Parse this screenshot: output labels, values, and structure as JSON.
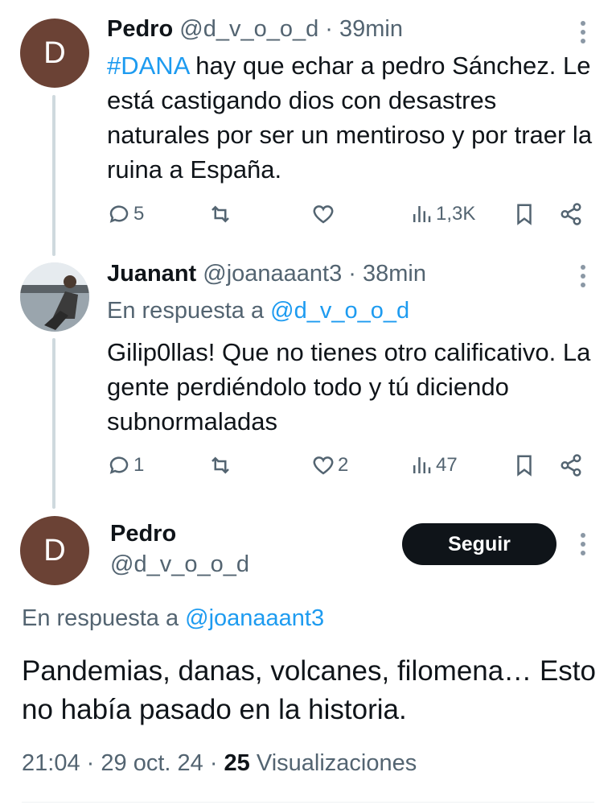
{
  "tweet1": {
    "avatar_letter": "D",
    "name": "Pedro",
    "handle": "@d_v_o_o_d",
    "separator": "·",
    "time": "39min",
    "hashtag": "#DANA",
    "text": " hay que echar a pedro Sánchez. Le está castigando dios con desastres naturales por ser un mentiroso y por traer la ruina a España.",
    "replies": "5",
    "likes": "",
    "views": "1,3K",
    "icons": [
      "reply-icon",
      "retweet-icon",
      "like-icon",
      "views-icon",
      "bookmark-icon",
      "share-icon"
    ]
  },
  "tweet2": {
    "name": "Juanant",
    "handle": "@joanaaant3",
    "separator": "·",
    "time": "38min",
    "reply_prefix": "En respuesta a ",
    "reply_to": "@d_v_o_o_d",
    "text": "Gilip0llas! Que no tienes otro calificativo. La gente perdiéndolo todo y tú diciendo subnormaladas",
    "replies": "1",
    "likes": "2",
    "views": "47"
  },
  "main_tweet": {
    "avatar_letter": "D",
    "name": "Pedro",
    "handle": "@d_v_o_o_d",
    "follow_label": "Seguir",
    "reply_prefix": "En respuesta a ",
    "reply_to": "@joanaaant3",
    "text": "Pandemias, danas, volcanes, filomena… Esto no había pasado en la historia.",
    "time": "21:04",
    "separator": "·",
    "date": "29 oct. 24",
    "views_count": "25",
    "views_label": "Visualizaciones"
  },
  "colors": {
    "accent": "#1d9bf0",
    "text": "#0f1419",
    "muted": "#536471",
    "avatar": "#6b4235"
  }
}
